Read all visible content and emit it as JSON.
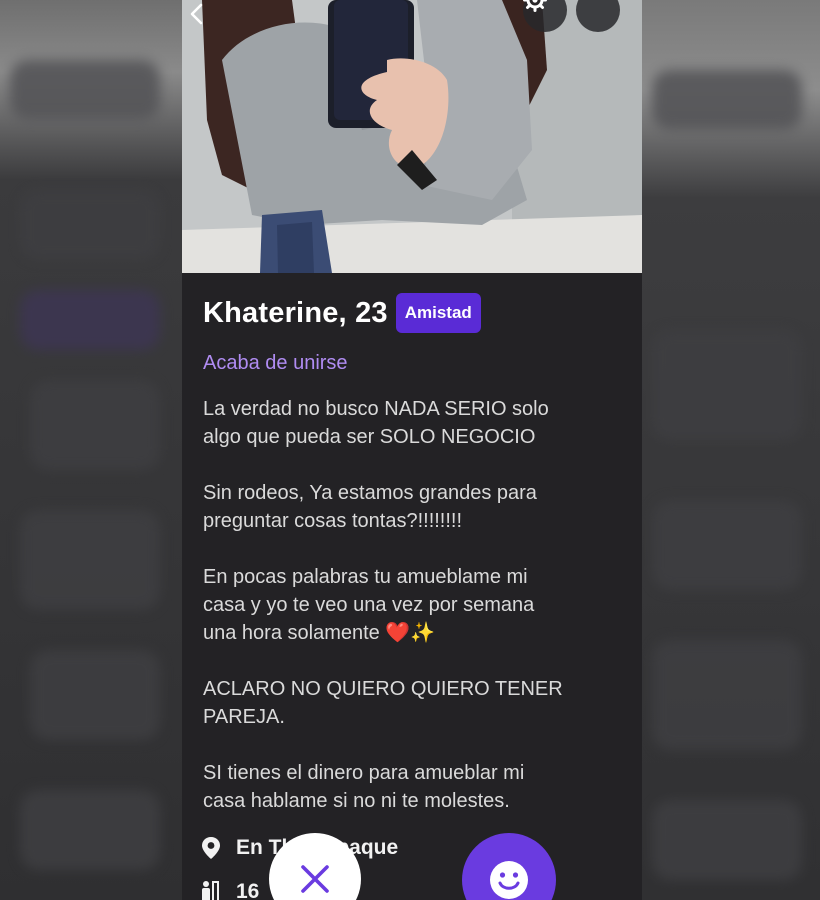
{
  "profile": {
    "name_age": "Khaterine, 23",
    "badge": "Amistad",
    "joined": "Acaba de unirse",
    "bio": [
      "La verdad no busco NADA SERIO solo\nalgo que pueda ser SOLO NEGOCIO",
      "Sin rodeos, Ya estamos grandes para\npreguntar cosas tontas?!!!!!!!!",
      "En pocas palabras tu amueblame mi\ncasa y yo te veo una vez por semana\nuna hora solamente ❤️✨",
      "ACLARO NO QUIERO QUIERO TENER\nPAREJA.",
      "SI tienes el dinero para amueblar mi\ncasa hablame si no ni te molestes."
    ],
    "location": "En Tlaquepaque",
    "height": "16"
  },
  "colors": {
    "accent": "#5a2bd6",
    "joined_text": "#b08cf2",
    "like_button": "#6a3be0"
  },
  "icons": {
    "back": "chevron-left-icon",
    "settings": "gear-icon",
    "more": "more-horizontal-icon",
    "location": "map-pin-icon",
    "height": "ruler-person-icon",
    "pass": "close-icon",
    "like": "smiley-icon"
  }
}
